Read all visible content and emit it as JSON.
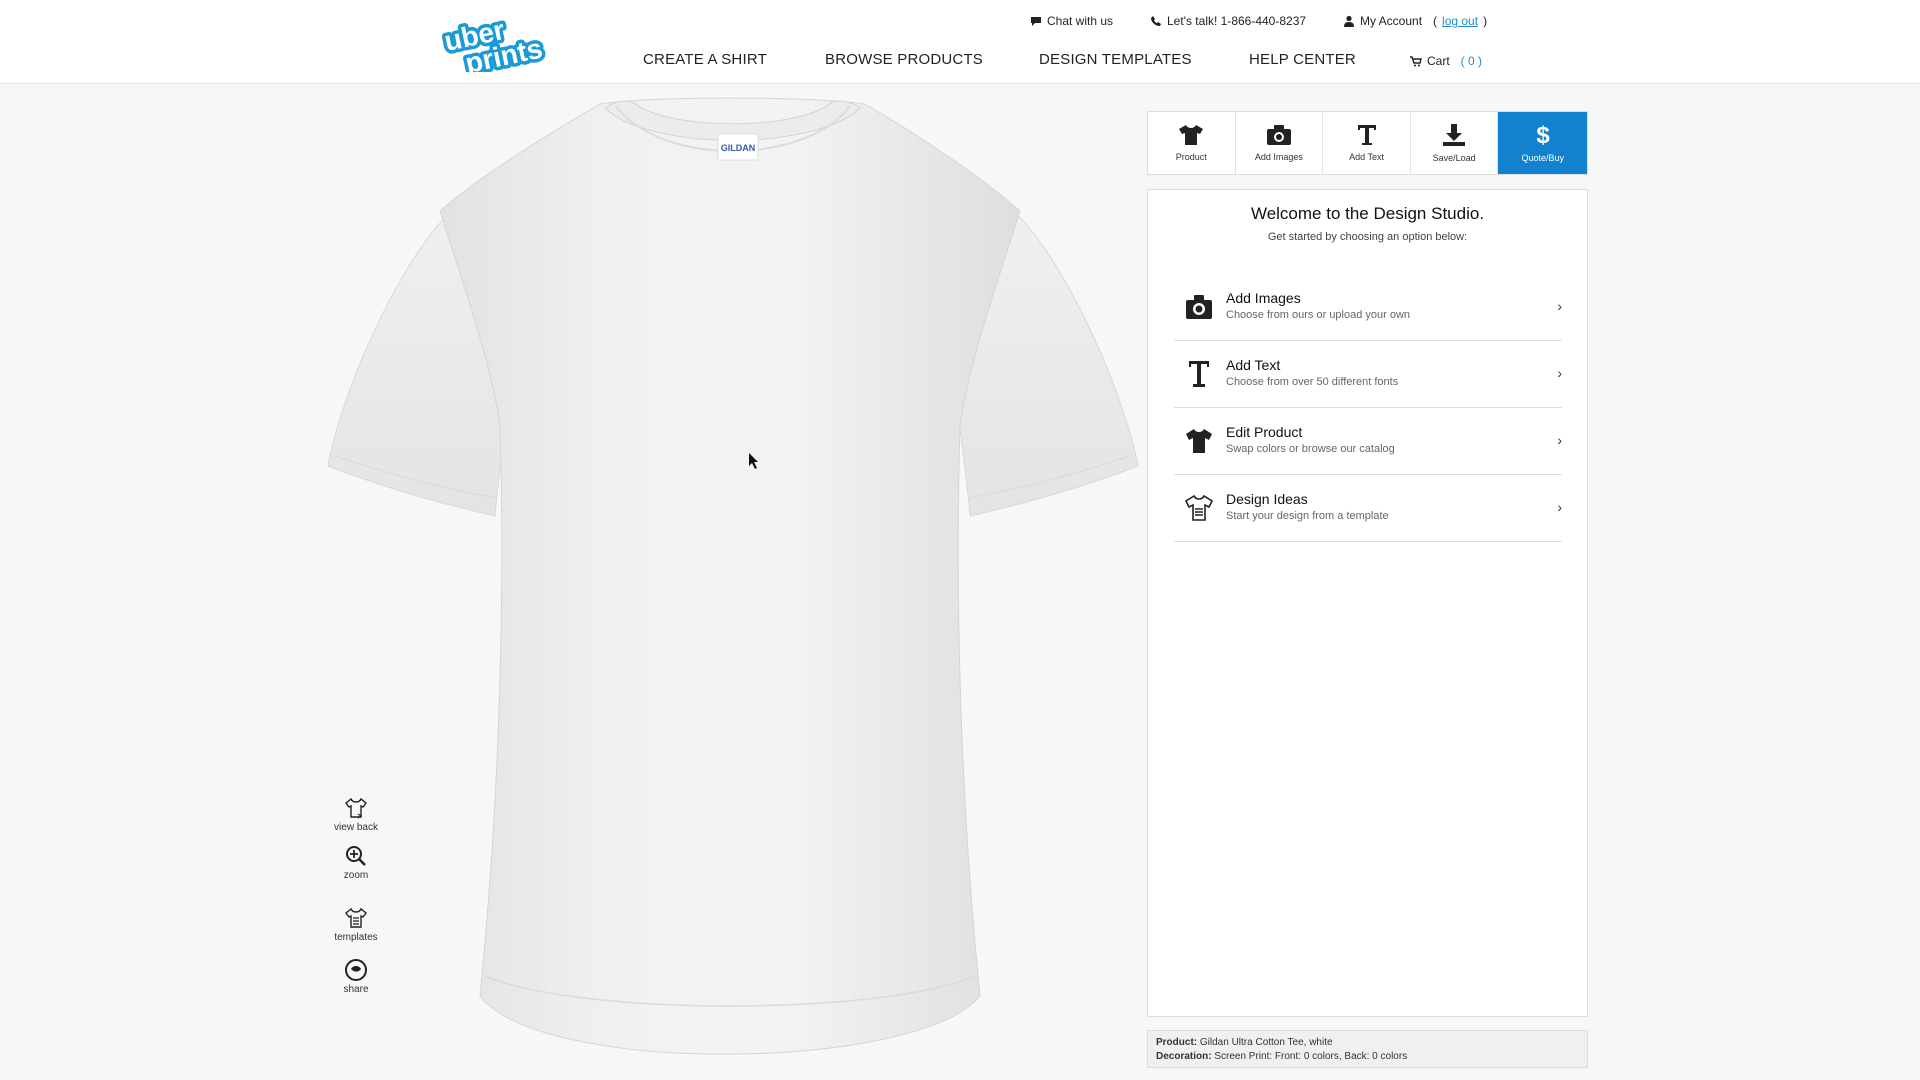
{
  "header": {
    "logo_text_top": "uber",
    "logo_text_bottom": "prints",
    "chat": "Chat with us",
    "phone": "Let's talk! 1-866-440-8237",
    "account": "My Account",
    "logout_open": "(",
    "logout": "log out",
    "logout_close": ")",
    "nav": [
      "CREATE A SHIRT",
      "BROWSE PRODUCTS",
      "DESIGN TEMPLATES",
      "HELP CENTER"
    ],
    "cart_label": "Cart",
    "cart_count": "( 0 )"
  },
  "shirt": {
    "tag_text": "GILDAN"
  },
  "tools": [
    {
      "label": "view back",
      "icon": "shirt-back-icon"
    },
    {
      "label": "zoom",
      "icon": "zoom-icon"
    },
    {
      "label": "templates",
      "icon": "templates-icon"
    },
    {
      "label": "share",
      "icon": "share-icon"
    }
  ],
  "toolbar": [
    {
      "label": "Product",
      "icon": "tshirt-icon"
    },
    {
      "label": "Add Images",
      "icon": "camera-icon"
    },
    {
      "label": "Add Text",
      "icon": "text-icon"
    },
    {
      "label": "Save/Load",
      "icon": "download-icon"
    },
    {
      "label": "Quote/Buy",
      "icon": "dollar-icon"
    }
  ],
  "panel": {
    "title": "Welcome to the Design Studio.",
    "subtitle": "Get started by choosing an option below:",
    "options": [
      {
        "title": "Add Images",
        "desc": "Choose from ours or upload your own",
        "icon": "camera-icon"
      },
      {
        "title": "Add Text",
        "desc": "Choose from over 50 different fonts",
        "icon": "text-icon"
      },
      {
        "title": "Edit Product",
        "desc": "Swap colors or browse our catalog",
        "icon": "tshirt-icon"
      },
      {
        "title": "Design Ideas",
        "desc": "Start your design from a template",
        "icon": "templates-icon"
      }
    ]
  },
  "info": {
    "product_label": "Product:",
    "product_value": "Gildan Ultra Cotton Tee, white",
    "decoration_label": "Decoration:",
    "decoration_value": "Screen Print: Front: 0 colors, Back: 0 colors"
  },
  "colors": {
    "accent": "#1282d0",
    "logo": "#1a9ad6"
  }
}
